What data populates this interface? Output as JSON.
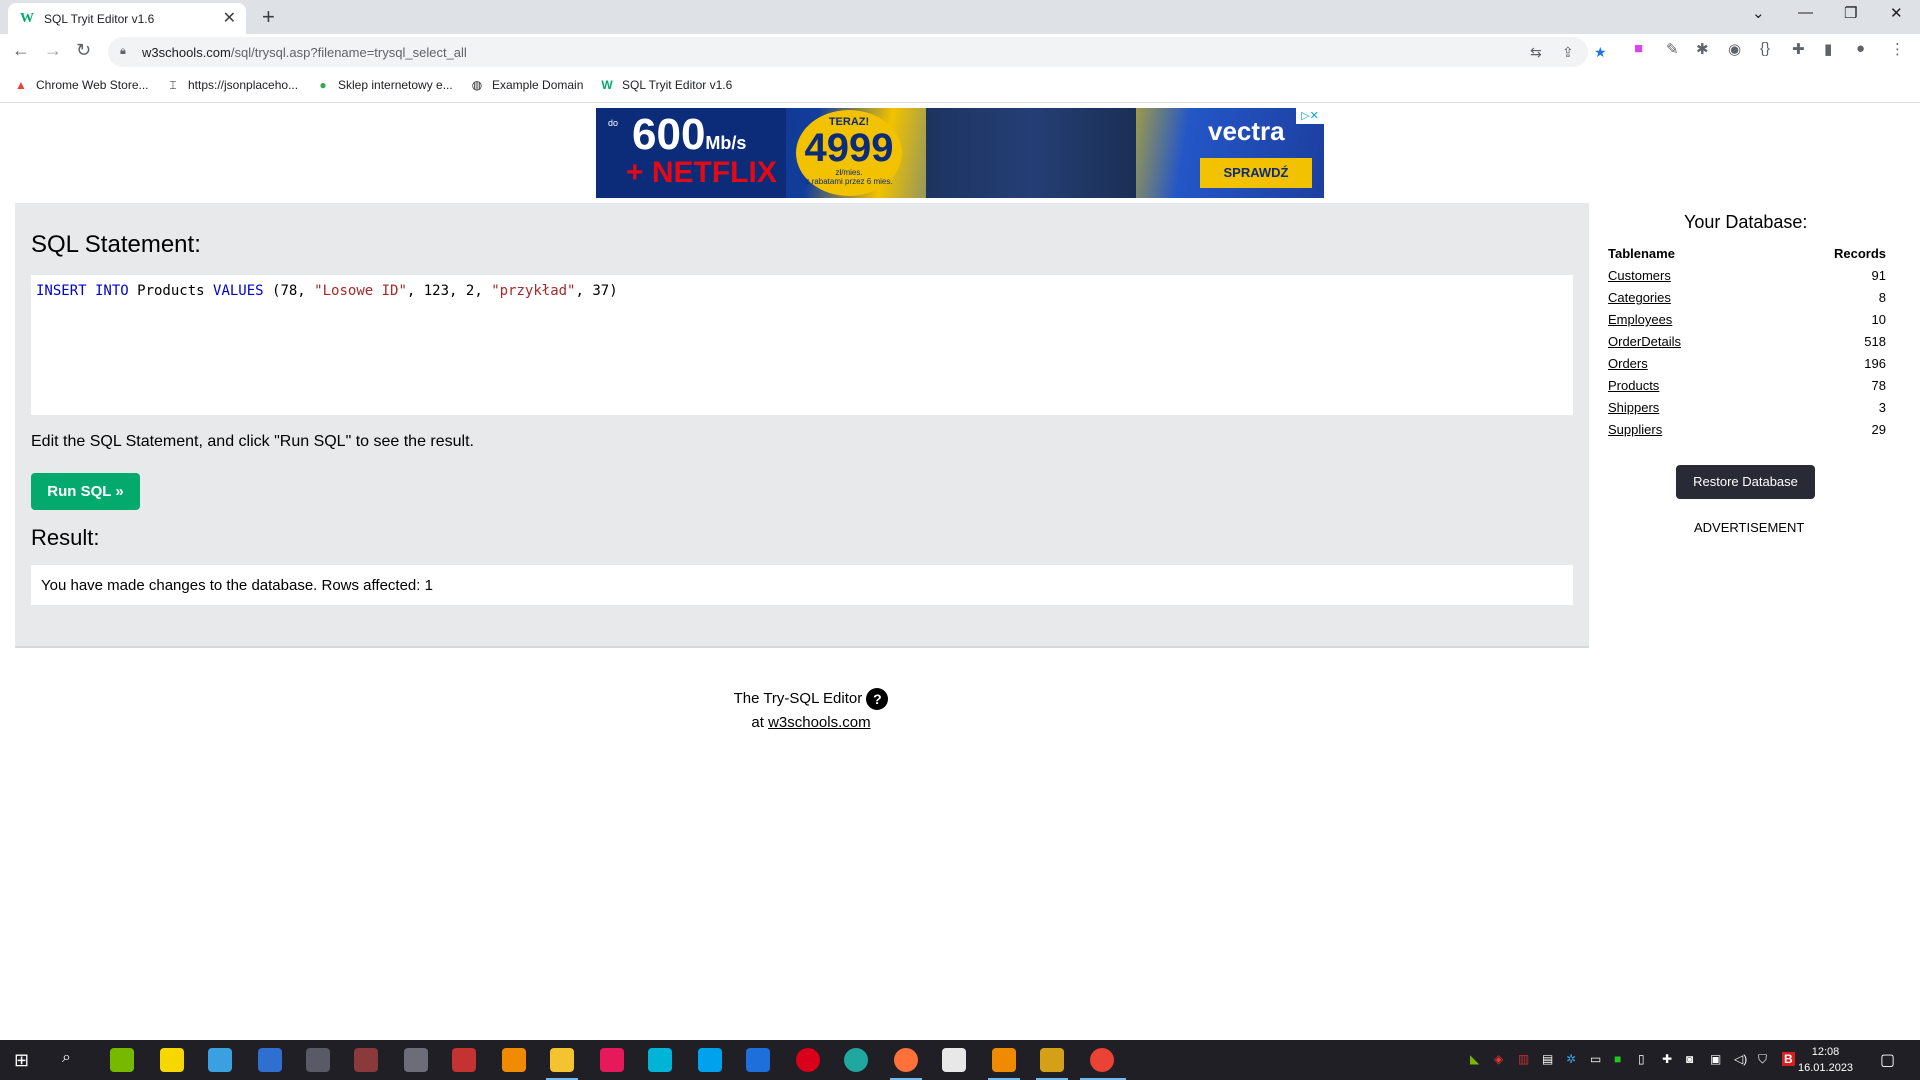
{
  "browser": {
    "tab_title": "SQL Tryit Editor v1.6",
    "tab_favicon": "W",
    "url_host": "w3schools.com",
    "url_path": "/sql/trysql.asp?filename=trysql_select_all",
    "bookmarks": [
      {
        "label": "Chrome Web Store...",
        "icon": "chrome-store-icon"
      },
      {
        "label": "https://jsonplaceho...",
        "icon": "page-icon"
      },
      {
        "label": "Sklep internetowy e...",
        "icon": "shop-icon"
      },
      {
        "label": "Example Domain",
        "icon": "globe-icon"
      },
      {
        "label": "SQL Tryit Editor v1.6",
        "icon": "w3schools-icon"
      }
    ]
  },
  "ad": {
    "prefix": "do",
    "speed": "600",
    "speed_unit": "Mb/s",
    "netflix": "+ NETFLIX",
    "now": "TERAZ!",
    "price": "4999",
    "price_unit": "zł/mies.",
    "note": "z rabatami przez 6 mies.",
    "brand": "vectra",
    "cta": "SPRAWDŹ"
  },
  "editor": {
    "heading": "SQL Statement:",
    "sql": {
      "kw1": "INSERT INTO",
      "t1": " Products ",
      "kw2": "VALUES",
      "t2": " (78, ",
      "s1": "\"Losowe ID\"",
      "t3": ", 123, 2, ",
      "s2": "\"przykład\"",
      "t4": ", 37)"
    },
    "hint": "Edit the SQL Statement, and click \"Run SQL\" to see the result.",
    "run_label": "Run SQL »",
    "result_heading": "Result:",
    "result_message": "You have made changes to the database. Rows affected: 1"
  },
  "database": {
    "title": "Your Database:",
    "col_name": "Tablename",
    "col_records": "Records",
    "tables": [
      {
        "name": "Customers",
        "records": "91"
      },
      {
        "name": "Categories",
        "records": "8"
      },
      {
        "name": "Employees",
        "records": "10"
      },
      {
        "name": "OrderDetails",
        "records": "518"
      },
      {
        "name": "Orders",
        "records": "196"
      },
      {
        "name": "Products",
        "records": "78"
      },
      {
        "name": "Shippers",
        "records": "3"
      },
      {
        "name": "Suppliers",
        "records": "29"
      }
    ],
    "restore_label": "Restore Database",
    "advertisement": "ADVERTISEMENT"
  },
  "footer": {
    "line1": "The Try-SQL Editor",
    "help": "?",
    "at": "at",
    "link": "w3schools.com"
  },
  "taskbar": {
    "time": "12:08",
    "date": "16.01.2023"
  },
  "colors": {
    "accent_green": "#04aa6d",
    "panel_bg": "#e7e9eb",
    "dark_button": "#282a35",
    "sql_keyword": "#0000cd",
    "sql_string": "#a52a2a"
  }
}
